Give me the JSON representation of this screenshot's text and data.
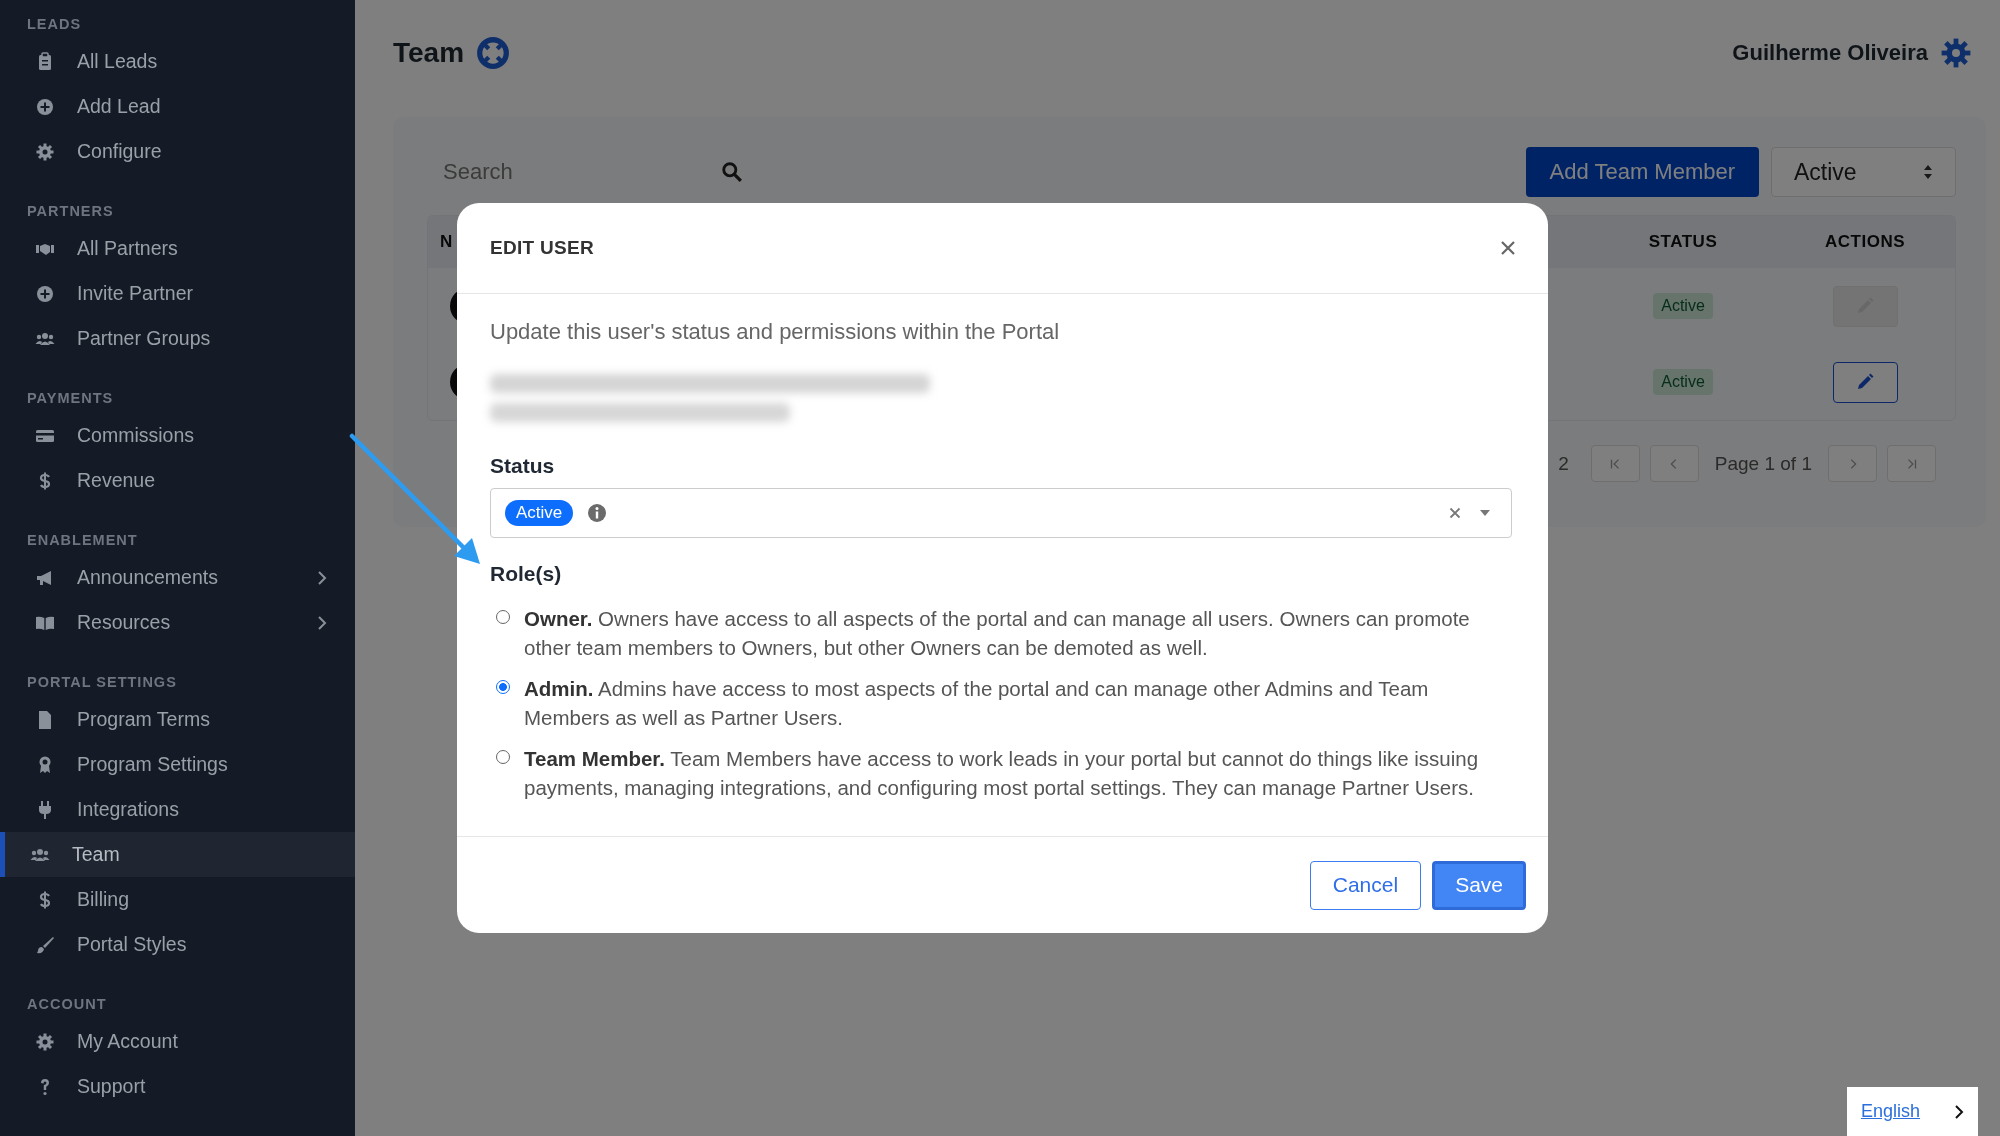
{
  "sidebar": {
    "sections": [
      {
        "title": "LEADS",
        "items": [
          {
            "label": "All Leads",
            "selected": false,
            "submenu": false
          },
          {
            "label": "Add Lead",
            "selected": false,
            "submenu": false
          },
          {
            "label": "Configure",
            "selected": false,
            "submenu": false
          }
        ]
      },
      {
        "title": "PARTNERS",
        "items": [
          {
            "label": "All Partners",
            "selected": false,
            "submenu": false
          },
          {
            "label": "Invite Partner",
            "selected": false,
            "submenu": false
          },
          {
            "label": "Partner Groups",
            "selected": false,
            "submenu": false
          }
        ]
      },
      {
        "title": "PAYMENTS",
        "items": [
          {
            "label": "Commissions",
            "selected": false,
            "submenu": false
          },
          {
            "label": "Revenue",
            "selected": false,
            "submenu": false
          }
        ]
      },
      {
        "title": "ENABLEMENT",
        "items": [
          {
            "label": "Announcements",
            "selected": false,
            "submenu": true
          },
          {
            "label": "Resources",
            "selected": false,
            "submenu": true
          }
        ]
      },
      {
        "title": "PORTAL SETTINGS",
        "items": [
          {
            "label": "Program Terms",
            "selected": false,
            "submenu": false
          },
          {
            "label": "Program Settings",
            "selected": false,
            "submenu": false
          },
          {
            "label": "Integrations",
            "selected": false,
            "submenu": false
          },
          {
            "label": "Team",
            "selected": true,
            "submenu": false
          },
          {
            "label": "Billing",
            "selected": false,
            "submenu": false
          },
          {
            "label": "Portal Styles",
            "selected": false,
            "submenu": false
          }
        ]
      },
      {
        "title": "ACCOUNT",
        "items": [
          {
            "label": "My Account",
            "selected": false,
            "submenu": false
          },
          {
            "label": "Support",
            "selected": false,
            "submenu": false
          }
        ]
      }
    ]
  },
  "header": {
    "title": "Team",
    "user": "Guilherme Oliveira"
  },
  "toolbar": {
    "search": {
      "placeholder": "Search"
    },
    "add_button": "Add Team Member",
    "filter": "Active"
  },
  "table": {
    "columns": [
      "N",
      "STATUS",
      "ACTIONS"
    ],
    "rows": [
      {
        "status": "Active",
        "edit_disabled": true
      },
      {
        "status": "Active",
        "edit_disabled": false
      }
    ]
  },
  "pagination": {
    "count": "2",
    "page": "Page 1 of 1"
  },
  "modal": {
    "title": "EDIT USER",
    "description": "Update this user's status and permissions within the Portal",
    "status_label": "Status",
    "status_chip": "Active",
    "roles_label": "Role(s)",
    "roles": [
      {
        "text": "**Owner.** Owners have access to all aspects of the portal and can manage all users. Owners can promote other team members to Owners, but other Owners can be demoted as well.",
        "selected": false
      },
      {
        "text": "**Admin.** Admins have access to most aspects of the portal and can manage other Admins and Team Members as well as Partner Users.",
        "selected": true
      },
      {
        "text": "**Team Member.** Team Members have access to work leads in your portal but cannot do things like issuing payments, managing integrations, and configuring most portal settings. They can manage Partner Users.",
        "selected": false
      }
    ],
    "buttons": [
      {
        "label": "Cancel",
        "kind": "secondary"
      },
      {
        "label": "Save",
        "kind": "primary"
      }
    ]
  },
  "language": {
    "label": "English"
  }
}
